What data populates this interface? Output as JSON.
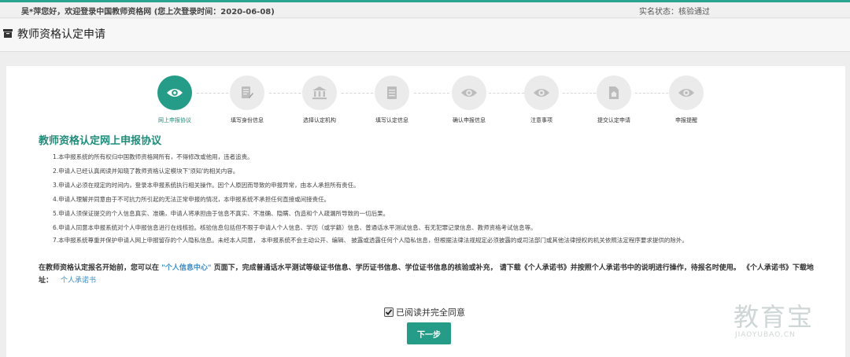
{
  "header": {
    "welcome": "吴*萍您好，欢迎登录中国教师资格网 (您上次登录时间：2020-06-08)",
    "status": "实名状态：核验通过"
  },
  "page": {
    "title": "教师资格认定申请"
  },
  "steps": [
    {
      "label": "网上申报协议",
      "icon": "eye-icon",
      "active": true
    },
    {
      "label": "填写身份信息",
      "icon": "edit-document-icon",
      "active": false
    },
    {
      "label": "选择认定机构",
      "icon": "institution-icon",
      "active": false
    },
    {
      "label": "填写认定信息",
      "icon": "document-icon",
      "active": false
    },
    {
      "label": "确认申报信息",
      "icon": "eye-icon",
      "active": false
    },
    {
      "label": "注意事项",
      "icon": "eye-icon",
      "active": false
    },
    {
      "label": "提交认定申请",
      "icon": "house-document-icon",
      "active": false
    },
    {
      "label": "申报提醒",
      "icon": "eye-icon",
      "active": false
    }
  ],
  "agreement": {
    "title": "教师资格认定网上申报协议",
    "items": [
      "1.本申报系统的所有权归中国教师资格网所有，不得修改或他用，违者追责。",
      "2.申请人已经认真阅读并知晓了教师资格认定模块下'须知'的相关内容。",
      "3.申请人必须在规定的时间内，登录本申报系统执行相关操作。因个人原因而导致的申报异常，由本人承担所有责任。",
      "4.申请人理解并同意由于不可抗力所引起的无法正常申报的情况，本申报系统不承担任何直接或间接责任。",
      "5.申请人须保证提交的个人信息真实、准确，申请人将承担由于信息不真实、不准确、隐瞒、伪造和个人疏漏所导致的一切后果。",
      "6.申请人同意本申报系统对个人申报信息进行在线核验。核验信息包括但不限于申请人个人信息、学历（或学籍）信息、普通话水平测试信息、有无犯罪记录信息、教师资格考试信息等。",
      "7.本申报系统尊重并保护申请人网上申报留存的个人隐私信息。未经本人同意， 本申报系统不会主动公开、编辑、 披露或透露任何个人隐私信息，但根据法律法规规定必须披露的或司法部门或其他法律授权的机关依照法定程序要求提供的除外。"
    ]
  },
  "notice": {
    "part1": "在教师资格认定报名开始前，您可以在 ",
    "highlight": "\"个人信息中心\"",
    "part2": " 页面下，完成普通话水平测试等级证书信息、学历证书信息、学位证书信息的核验或补充， 请下载《个人承诺书》并按照个人承诺书中的说明进行操作，待报名时使用。 《个人承诺书》下载地址：",
    "link": "个人承诺书"
  },
  "agree": {
    "label": "已阅读并完全同意",
    "checked": true
  },
  "buttons": {
    "next": "下一步"
  },
  "watermark": {
    "brand": "教育宝",
    "domain": "JIAOYUBAO.CN"
  },
  "colors": {
    "accent": "#249c87",
    "link": "#3a8fc9",
    "inactive_step": "#ebebeb"
  }
}
